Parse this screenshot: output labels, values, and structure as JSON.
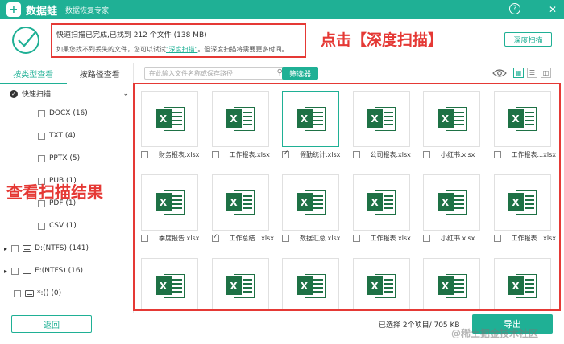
{
  "app": {
    "logo_glyph": "+",
    "name": "数据蛙",
    "subtitle": "数据恢复专家"
  },
  "window": {
    "help": "?",
    "minimize": "—",
    "close": "✕"
  },
  "status": {
    "line1": "快速扫描已完成,已找到 212 个文件 (138 MB)",
    "line2_prefix": "如果您找不到丢失的文件，您可以试试",
    "line2_link": "\"深度扫描\"",
    "line2_suffix": "。但深度扫描将需要更多时间。"
  },
  "annotations": {
    "top": "点击【深度扫描】",
    "left": "查看扫描结果"
  },
  "deep_scan_button": "深度扫描",
  "tabs": [
    "按类型查看",
    "按路径查看"
  ],
  "tree": {
    "root": "快速扫描",
    "types": [
      "DOCX (16)",
      "TXT (4)",
      "PPTX (5)",
      "PUB (1)",
      "PDF (1)",
      "CSV (1)"
    ],
    "drives": [
      "D:(NTFS) (141)",
      "E:(NTFS) (16)",
      "*:() (0)"
    ]
  },
  "search": {
    "placeholder": "在此输入文件名称或保存路径"
  },
  "filter_button": "筛选器",
  "files": [
    {
      "name": "财务报表.xlsx",
      "checked": false
    },
    {
      "name": "工作报表.xlsx",
      "checked": false
    },
    {
      "name": "假勤统计.xlsx",
      "checked": true
    },
    {
      "name": "公司报表.xlsx",
      "checked": false
    },
    {
      "name": "小红书.xlsx",
      "checked": false
    },
    {
      "name": "工作报表...xlsx",
      "checked": false
    },
    {
      "name": "季度报告.xlsx",
      "checked": false
    },
    {
      "name": "工作总结...xlsx",
      "checked": true
    },
    {
      "name": "数据汇总.xlsx",
      "checked": false
    },
    {
      "name": "工作报表.xlsx",
      "checked": false
    },
    {
      "name": "小红书.xlsx",
      "checked": false
    },
    {
      "name": "工作报表...xlsx",
      "checked": false
    },
    {
      "name": "",
      "checked": false
    },
    {
      "name": "",
      "checked": false
    },
    {
      "name": "",
      "checked": false
    },
    {
      "name": "",
      "checked": false
    },
    {
      "name": "",
      "checked": false
    },
    {
      "name": "",
      "checked": false
    }
  ],
  "file_badge": "X",
  "bottom": {
    "back": "返回",
    "selection": "已选择 2个项目/ 705 KB",
    "export": "导出",
    "watermark": "@稀土掘金技术社区"
  },
  "colors": {
    "accent": "#1fb095",
    "annotation": "#e53935",
    "excel": "#1e7145"
  }
}
